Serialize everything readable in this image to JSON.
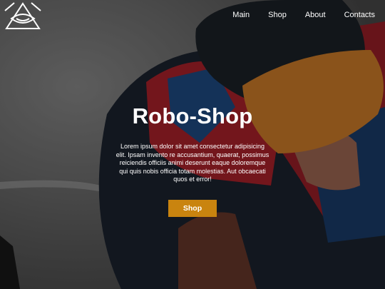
{
  "nav": {
    "items": [
      {
        "label": "Main"
      },
      {
        "label": "Shop"
      },
      {
        "label": "About"
      },
      {
        "label": "Contacts"
      }
    ]
  },
  "hero": {
    "title": "Robo-Shop",
    "description": "Lorem ipsum dolor sit amet consectetur adipisicing elit. Ipsam invento re accusantium, quaerat, possimus reiciendis officiis animi deserunt eaque doloremque qui quis nobis officia totam molestias. Aut obcaecati quos et error!",
    "button_label": "Shop"
  },
  "colors": {
    "accent": "#c9840f",
    "text": "#ffffff"
  },
  "icons": {
    "logo": "eye-triangle-icon"
  }
}
